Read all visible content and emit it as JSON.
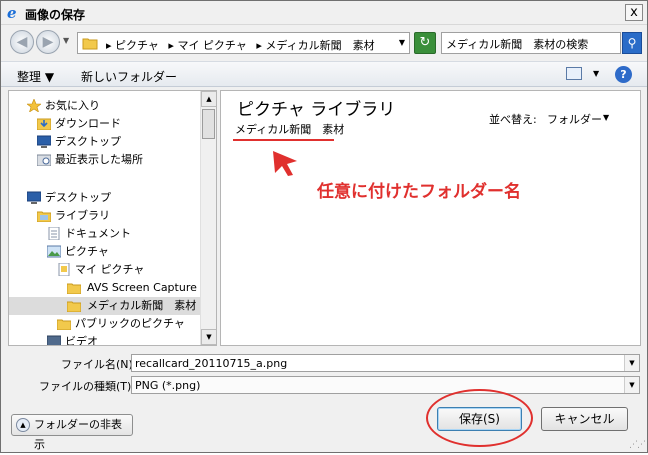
{
  "window": {
    "title": "画像の保存",
    "close_label": "x"
  },
  "nav": {
    "breadcrumbs": [
      "▸ ピクチャ",
      "▸ マイ ピクチャ",
      "▸ メディカル新聞　素材"
    ],
    "search_text": "メディカル新聞　素材の検索"
  },
  "toolbar": {
    "organize": "整理 ▼",
    "new_folder": "新しいフォルダー"
  },
  "tree": {
    "items": [
      {
        "label": "お気に入り",
        "icon": "star-icon"
      },
      {
        "label": "ダウンロード",
        "icon": "download-folder-icon"
      },
      {
        "label": "デスクトップ",
        "icon": "desktop-icon"
      },
      {
        "label": "最近表示した場所",
        "icon": "recent-places-icon"
      },
      {
        "label": "デスクトップ",
        "icon": "desktop-icon"
      },
      {
        "label": "ライブラリ",
        "icon": "library-icon"
      },
      {
        "label": "ドキュメント",
        "icon": "document-icon"
      },
      {
        "label": "ピクチャ",
        "icon": "pictures-icon"
      },
      {
        "label": "マイ ピクチャ",
        "icon": "folder-icon"
      },
      {
        "label": "AVS Screen Capture",
        "icon": "folder-icon"
      },
      {
        "label": "メディカル新聞　素材",
        "icon": "folder-icon"
      },
      {
        "label": "パブリックのピクチャ",
        "icon": "folder-icon"
      },
      {
        "label": "ビデオ",
        "icon": "video-icon"
      }
    ]
  },
  "content": {
    "library_title": "ピクチャ ライブラリ",
    "library_subtitle": "メディカル新聞　素材",
    "sort_label": "並べ替え:",
    "sort_value": "フォルダー",
    "annotation": "任意に付けたフォルダー名"
  },
  "fields": {
    "filename_label": "ファイル名(N):",
    "filename_value": "recallcard_20110715_a.png",
    "filetype_label": "ファイルの種類(T):",
    "filetype_value": "PNG (*.png)"
  },
  "buttons": {
    "hide_folders": "フォルダーの非表示",
    "save": "保存(S)",
    "cancel": "キャンセル"
  },
  "colors": {
    "annotation_red": "#e0302e",
    "selection_gray": "#dcdcdc"
  }
}
